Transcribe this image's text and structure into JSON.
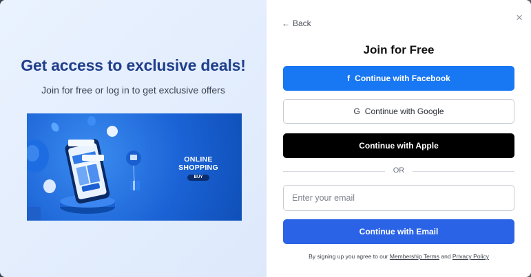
{
  "promo": {
    "headline": "Get access to exclusive deals!",
    "subhead": "Join for free or log in to get exclusive offers",
    "banner_title_line1": "ONLINE",
    "banner_title_line2": "SHOPPING",
    "banner_buy": "BUY"
  },
  "signup": {
    "close_glyph": "×",
    "back_arrow": "←",
    "back_label": "Back",
    "title": "Join for Free",
    "facebook_icon": "f",
    "facebook_label": "Continue with Facebook",
    "google_icon": "G",
    "google_label": "Continue with Google",
    "apple_label": "Continue with Apple",
    "divider_label": "OR",
    "email_placeholder": "Enter your email",
    "email_button_label": "Continue with Email",
    "terms_prefix": "By signing up you agree to our",
    "terms_link1": "Membership Terms",
    "terms_and": "and",
    "terms_link2": "Privacy Policy"
  },
  "colors": {
    "facebook": "#1877f2",
    "apple": "#000000",
    "email_button": "#2b63e6",
    "headline": "#1f3e8a"
  }
}
